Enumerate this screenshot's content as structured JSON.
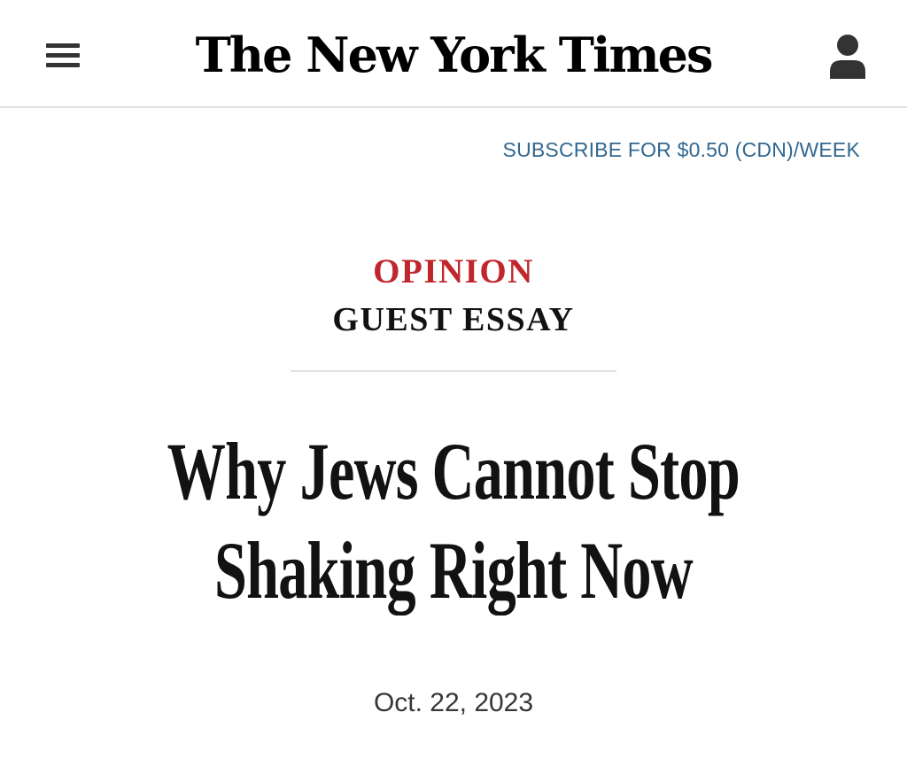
{
  "header": {
    "logo_text": "The New York Times",
    "menu_icon": "hamburger-menu-icon",
    "account_icon": "user-account-icon"
  },
  "subscribe": {
    "label": "SUBSCRIBE FOR $0.50 (CDN)/WEEK",
    "color": "#326891"
  },
  "article": {
    "section": "OPINION",
    "section_color": "#c0272d",
    "label": "GUEST ESSAY",
    "headline_line1": "Why Jews Cannot Stop",
    "headline_line2": "Shaking Right Now",
    "date": "Oct. 22, 2023"
  }
}
